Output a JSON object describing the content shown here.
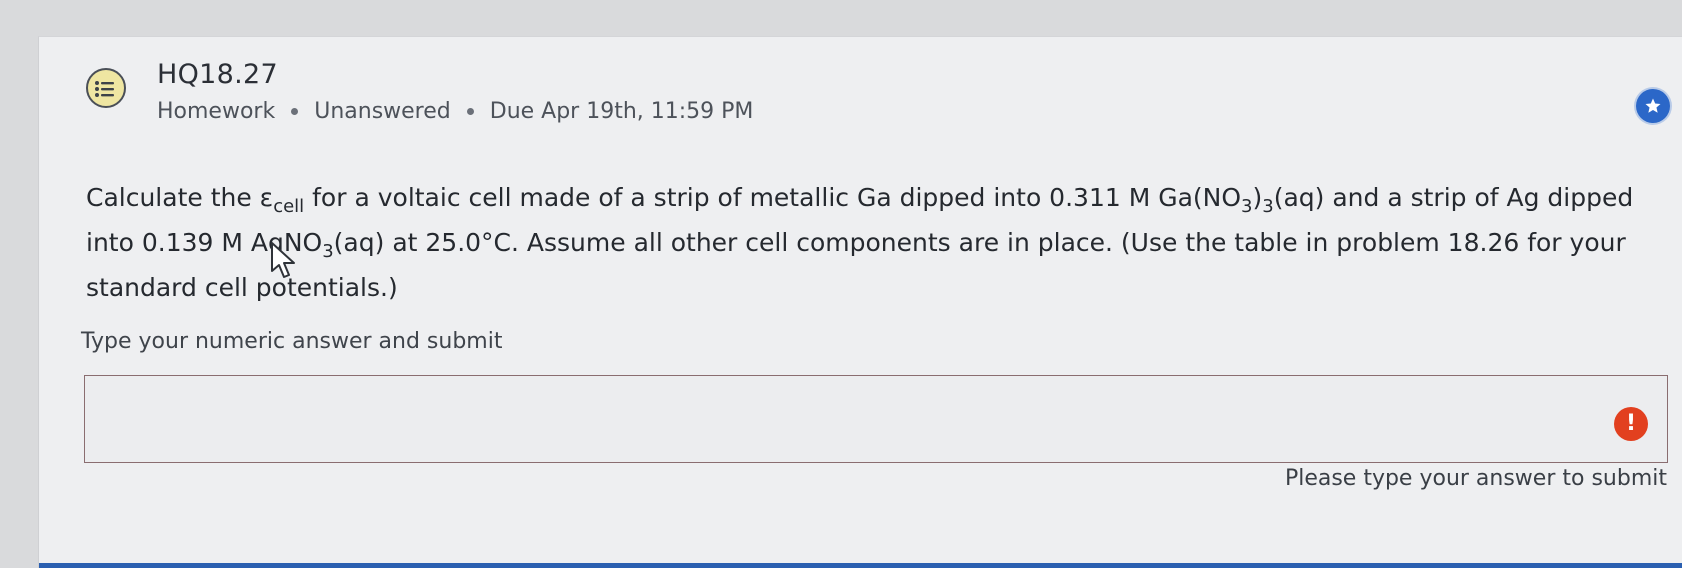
{
  "question": {
    "title": "HQ18.27",
    "meta": {
      "type": "Homework",
      "status": "Unanswered",
      "due": "Due Apr 19th, 11:59 PM"
    },
    "text": {
      "p1": "Calculate the ε",
      "sub_cell": "cell",
      "p2": " for a voltaic cell made of a strip of metallic Ga dipped into 0.311 M Ga(NO",
      "sub_3a": "3",
      "p3": ")",
      "sub_3b": "3",
      "p4": "(aq) and a strip of Ag dipped into 0.139 M AgNO",
      "sub_3c": "3",
      "p5": "(aq) at 25.0°C. Assume all other cell components are in place. (Use the table in problem 18.26 for your standard cell potentials.)"
    }
  },
  "answer": {
    "prompt": "Type your numeric answer and submit",
    "value": "",
    "error_icon": "!",
    "error_message": "Please type your answer to submit"
  },
  "icons": {
    "question_icon": "list-icon",
    "bookmark_icon": "star-icon",
    "error_icon": "exclamation-icon",
    "cursor": "mouse-pointer-icon"
  },
  "colors": {
    "accent": "#2b67c8",
    "error": "#e2401f",
    "icon_bg": "#efe6a2",
    "bottom_bar": "#2a5fb0"
  }
}
